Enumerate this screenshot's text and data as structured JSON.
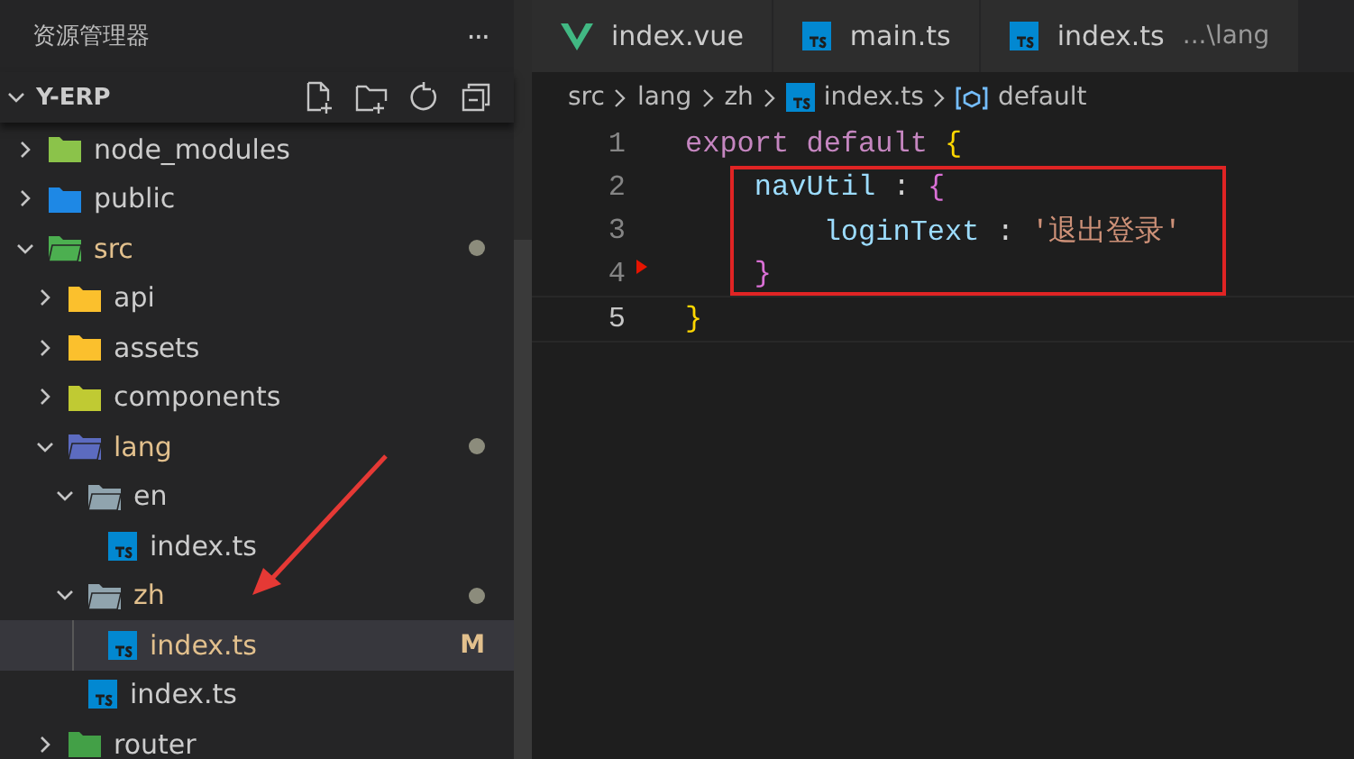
{
  "sidebar": {
    "title": "资源管理器",
    "more": "···",
    "project": {
      "name": "Y-ERP",
      "expanded": true
    },
    "tree": [
      {
        "name": "node_modules",
        "kind": "folder",
        "color": "#8bc34a",
        "expanded": false,
        "modified": false,
        "selected": false
      },
      {
        "name": "public",
        "kind": "folder",
        "color": "#1e88e5",
        "expanded": false,
        "modified": false,
        "selected": false
      },
      {
        "name": "src",
        "kind": "folder",
        "color": "#4caf50",
        "expanded": true,
        "modified": true,
        "selected": false,
        "children": [
          {
            "name": "api",
            "kind": "folder",
            "color": "#fbc02d",
            "expanded": false,
            "modified": false,
            "selected": false
          },
          {
            "name": "assets",
            "kind": "folder",
            "color": "#fbc02d",
            "expanded": false,
            "modified": false,
            "selected": false
          },
          {
            "name": "components",
            "kind": "folder",
            "color": "#c0ca33",
            "expanded": false,
            "modified": false,
            "selected": false
          },
          {
            "name": "lang",
            "kind": "folder",
            "color": "#5c6bc0",
            "expanded": true,
            "modified": true,
            "selected": false,
            "children": [
              {
                "name": "en",
                "kind": "folder",
                "color": "#90a4ae",
                "expanded": true,
                "modified": false,
                "selected": false,
                "children": [
                  {
                    "name": "index.ts",
                    "kind": "file",
                    "modified": false,
                    "selected": false
                  }
                ]
              },
              {
                "name": "zh",
                "kind": "folder",
                "color": "#90a4ae",
                "expanded": true,
                "modified": true,
                "selected": false,
                "children": [
                  {
                    "name": "index.ts",
                    "kind": "file",
                    "modified": true,
                    "selected": true,
                    "badge": "M"
                  }
                ]
              },
              {
                "name": "index.ts",
                "kind": "file",
                "modified": false,
                "selected": false
              }
            ]
          },
          {
            "name": "router",
            "kind": "folder",
            "color": "#43a047",
            "expanded": false,
            "modified": false,
            "selected": false
          }
        ]
      }
    ]
  },
  "tabs": [
    {
      "label": "index.vue",
      "kind": "vue"
    },
    {
      "label": "main.ts",
      "kind": "ts"
    },
    {
      "label": "index.ts",
      "kind": "ts",
      "description": "...\\lang"
    }
  ],
  "breadcrumb": [
    {
      "label": "src",
      "kind": "folder"
    },
    {
      "label": "lang",
      "kind": "folder"
    },
    {
      "label": "zh",
      "kind": "folder"
    },
    {
      "label": "index.ts",
      "kind": "file"
    },
    {
      "label": "default",
      "kind": "symbol"
    }
  ],
  "editor": {
    "lines": [
      {
        "number": "1",
        "current": false,
        "tokens": [
          {
            "text": "export",
            "kind": "keyword"
          },
          {
            "text": "default",
            "kind": "keyword"
          },
          {
            "text": "{",
            "kind": "bracket1"
          }
        ]
      },
      {
        "number": "2",
        "current": false,
        "tokens": [
          {
            "text": "navUtil",
            "kind": "property"
          },
          {
            "text": ":",
            "kind": "plain"
          },
          {
            "text": "{",
            "kind": "bracket2"
          }
        ]
      },
      {
        "number": "3",
        "current": false,
        "tokens": [
          {
            "text": "loginText",
            "kind": "property"
          },
          {
            "text": ":",
            "kind": "plain"
          },
          {
            "text": "'退出登录'",
            "kind": "string"
          }
        ]
      },
      {
        "number": "4",
        "current": false,
        "tokens": [
          {
            "text": "}",
            "kind": "bracket2"
          }
        ]
      },
      {
        "number": "5",
        "current": true,
        "tokens": [
          {
            "text": "}",
            "kind": "bracket1"
          }
        ]
      }
    ]
  }
}
